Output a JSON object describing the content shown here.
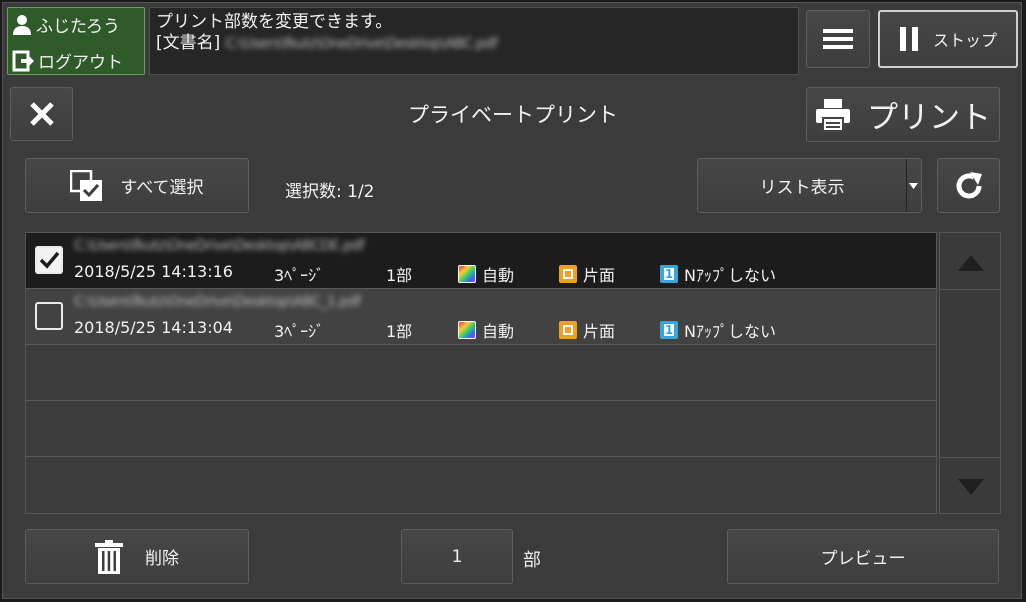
{
  "user": {
    "name": "ふじたろう",
    "logout_label": "ログアウト"
  },
  "message": {
    "line1": "プリント部数を変更できます。",
    "doc_prefix": "[文書名]",
    "doc_name": "C:\\Users\\fkutz\\OneDrive\\Desktop\\ABC.pdf"
  },
  "header": {
    "menu_icon": "hamburger-icon",
    "stop_label": "ストップ"
  },
  "title_bar": {
    "title": "プライベートプリント",
    "close_icon": "close-icon",
    "print_label": "プリント"
  },
  "toolbar": {
    "select_all_label": "すべて選択",
    "selection_count_label": "選択数:",
    "selection_count": "1/2",
    "view_mode_label": "リスト表示",
    "refresh_icon": "refresh-icon"
  },
  "jobs": [
    {
      "checked": true,
      "file_name": "C:\\Users\\fkutz\\OneDrive\\Desktop\\ABCDE.pdf",
      "datetime": "2018/5/25  14:13:16",
      "pages": "3ﾍﾟｰｼﾞ",
      "copies": "1部",
      "color": "自動",
      "sides": "片面",
      "nup": "Nｱｯﾌﾟしない"
    },
    {
      "checked": false,
      "file_name": "C:\\Users\\fkutz\\OneDrive\\Desktop\\ABC_1.pdf",
      "datetime": "2018/5/25  14:13:04",
      "pages": "3ﾍﾟｰｼﾞ",
      "copies": "1部",
      "color": "自動",
      "sides": "片面",
      "nup": "Nｱｯﾌﾟしない"
    }
  ],
  "footer": {
    "delete_label": "削除",
    "copies_value": "1",
    "copies_unit": "部",
    "preview_label": "プレビュー"
  },
  "colors": {
    "user_bg": "#2f5a2a",
    "selected_row": "#1c1c1c",
    "sides_icon": "#f0a020",
    "nup_icon": "#3aa6d8"
  }
}
